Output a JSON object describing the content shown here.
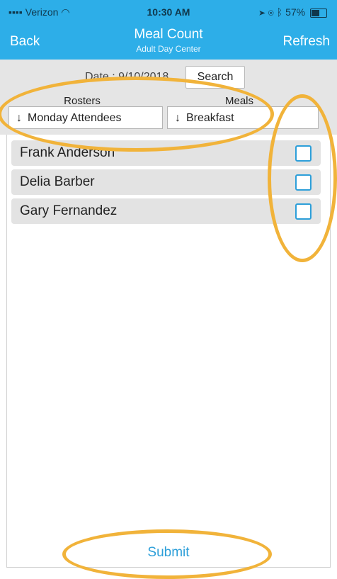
{
  "status_bar": {
    "carrier": "Verizon",
    "time": "10:30 AM",
    "battery": "57%",
    "battery_level": 0.57
  },
  "nav": {
    "back_label": "Back",
    "title": "Meal Count",
    "subtitle": "Adult Day Center",
    "refresh_label": "Refresh"
  },
  "filter": {
    "date_text": "Date : 9/10/2018",
    "search_label": "Search",
    "rosters_label": "Rosters",
    "meals_label": "Meals",
    "roster_value": "Monday Attendees",
    "meal_value": "Breakfast",
    "dropdown_arrow": "↓"
  },
  "attendees": [
    {
      "name": "Frank Anderson",
      "checked": false
    },
    {
      "name": "Delia Barber",
      "checked": false
    },
    {
      "name": "Gary Fernandez",
      "checked": false
    }
  ],
  "submit_label": "Submit",
  "colors": {
    "nav_bar": "#2daee8",
    "accent": "#2d9fd9",
    "highlight": "#f1b33a",
    "row_bg": "#e3e3e3"
  }
}
